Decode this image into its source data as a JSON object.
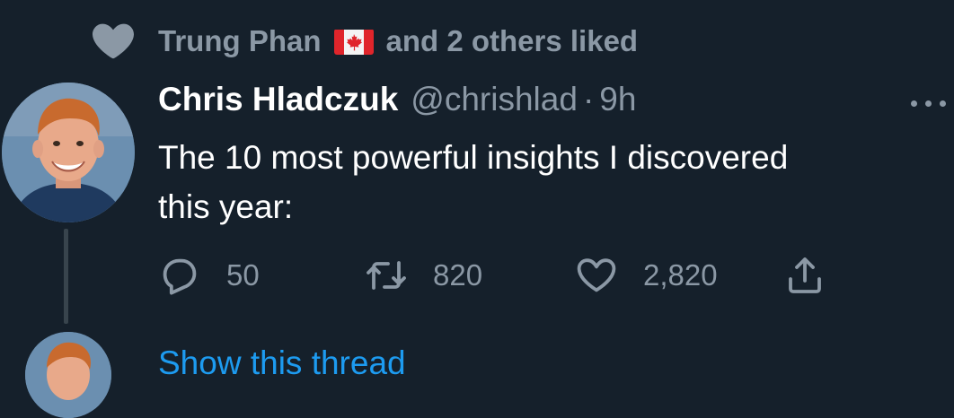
{
  "social_context": {
    "icon": "heart-icon",
    "liker_name": "Trung Phan",
    "liker_flag": "canada-flag",
    "suffix": "and 2 others liked"
  },
  "tweet": {
    "author": {
      "display_name": "Chris Hladczuk",
      "handle": "@chrishlad",
      "avatar": "avatar-chris"
    },
    "separator": "·",
    "time": "9h",
    "text": "The 10 most powerful insights I discovered\nthis year:",
    "actions": {
      "reply_count": "50",
      "retweet_count": "820",
      "like_count": "2,820"
    },
    "more_icon": "more-icon"
  },
  "thread": {
    "show_thread_label": "Show this thread"
  },
  "colors": {
    "background": "#15202b",
    "primary_text": "#ffffff",
    "secondary_text": "#8b98a5",
    "link": "#1d9bf0",
    "thread_line": "#38444d"
  }
}
